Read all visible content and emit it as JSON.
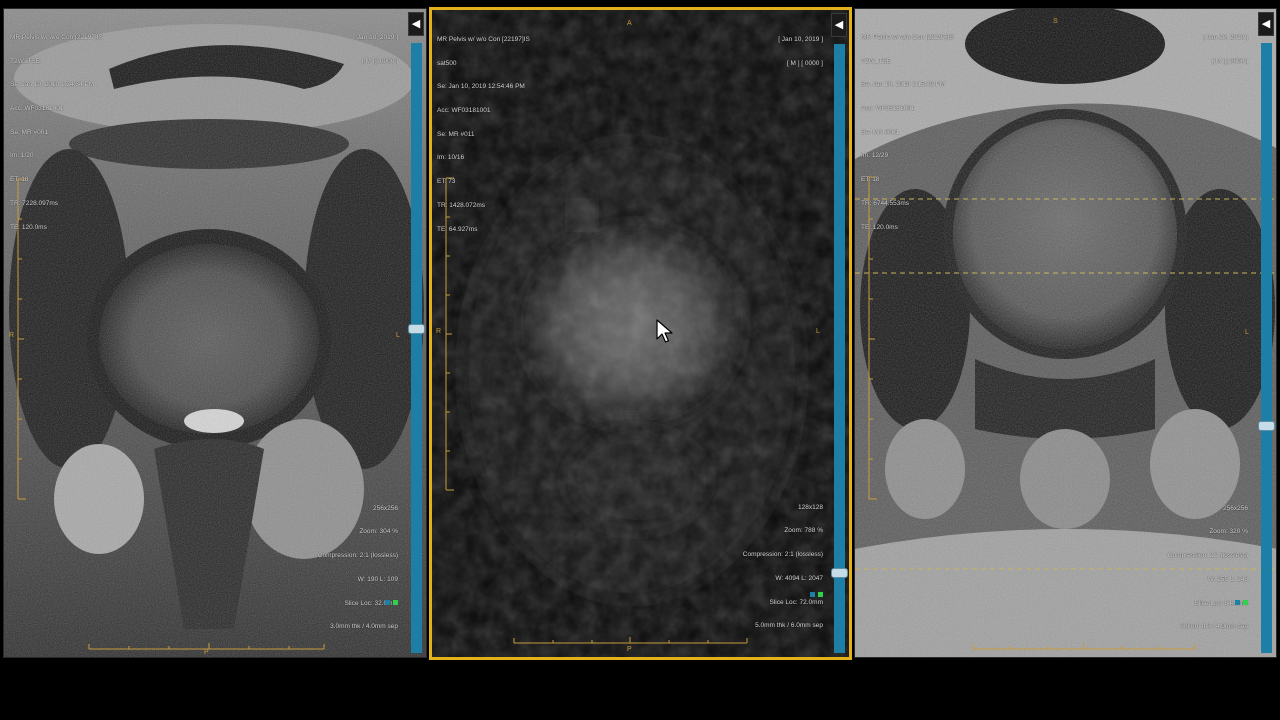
{
  "viewports": [
    {
      "id": "left",
      "top_left": [
        "MR Pelvis w/ w/o Con [22197]IS",
        "T2W_TSE",
        "Se: Jan 10, 2019 1:24:34 PM",
        "Acc: WF03181001",
        "Se: MR #001",
        "Im: 1/20",
        "ET: 18",
        "TR: 7228.097ms",
        "TE: 120.0ms"
      ],
      "top_right": [
        "[ Jan 10, 2019 ]",
        "[ M ] [ 0000 ]"
      ],
      "bottom_right": [
        "256x256",
        "Zoom: 304 %",
        "Compression: 2:1 (lossless)",
        "W: 190 L: 109",
        "Slice Loc: 32.0mm",
        "3.0mm thk / 4.0mm sep"
      ],
      "orient_left": "R",
      "orient_right": "L",
      "orient_bottom": "P",
      "scroll_pos": 0.46
    },
    {
      "id": "middle",
      "top_left": [
        "MR Pelvis w/ w/o Con [22197]IS",
        "sat500",
        "Se: Jan 10, 2019 12:54:46 PM",
        "Acc: WF03181001",
        "Se: MR #011",
        "Im: 10/16",
        "ET: 73",
        "TR: 1428.072ms",
        "TE: 64.927ms"
      ],
      "top_right": [
        "[ Jan 10, 2019 ]",
        "[ M ] [ 0000 ]"
      ],
      "bottom_right": [
        "128x128",
        "Zoom: 788 %",
        "Compression: 2:1 (lossless)",
        "W: 4094 L: 2047",
        "Slice Loc: 72.0mm",
        "5.0mm thk / 6.0mm sep"
      ],
      "orient_top": "A",
      "orient_left": "R",
      "orient_right": "L",
      "orient_bottom": "P",
      "scroll_pos": 0.86
    },
    {
      "id": "right",
      "top_left": [
        "MR Pelvis w/ w/o Con [22197]IS",
        "T2W_TSE",
        "Se: Jan 10, 2019 1:15:49 PM",
        "Acc: WF03181001",
        "Se: MR #001",
        "Im: 12/29",
        "ET: 18",
        "TR: 6744.553ms",
        "TE: 120.0ms"
      ],
      "top_right": [
        "[ Jan 10, 2019 ]",
        "[ M ] [ 0000 ]"
      ],
      "bottom_right": [
        "256x256",
        "Zoom: 320 %",
        "Compression: 2:1 (lossless)",
        "W: 255 L: 143",
        "Slice Loc: 84.0mm",
        "3.0mm thk / 4.0mm sep"
      ],
      "orient_top": "S",
      "orient_right": "L",
      "scroll_pos": 0.62
    }
  ],
  "icons": {
    "collapse": "triangle-left-icon",
    "cursor": "mouse-pointer-icon"
  },
  "colors": {
    "active_border": "#e3b21a",
    "scrollbar": "#1e7fa6",
    "ruler": "#c89b3c",
    "reference_line": "#c9b45a"
  }
}
